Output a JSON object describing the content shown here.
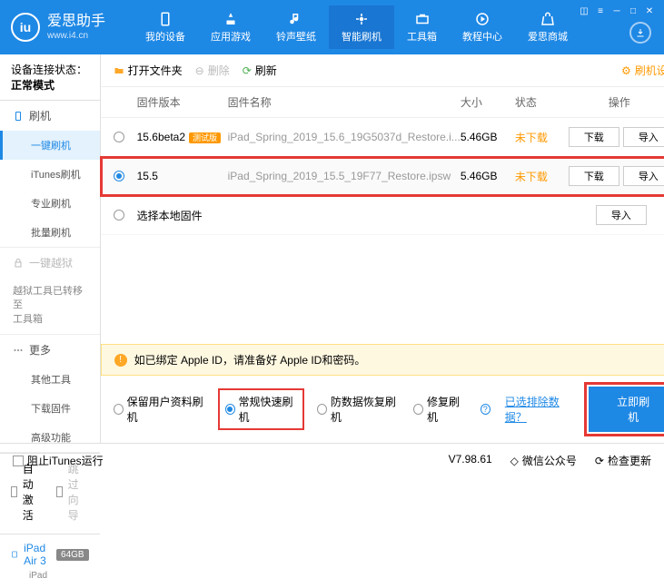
{
  "app": {
    "title": "爱思助手",
    "url": "www.i4.cn"
  },
  "nav": [
    {
      "label": "我的设备"
    },
    {
      "label": "应用游戏"
    },
    {
      "label": "铃声壁纸"
    },
    {
      "label": "智能刷机"
    },
    {
      "label": "工具箱"
    },
    {
      "label": "教程中心"
    },
    {
      "label": "爱思商城"
    }
  ],
  "sidebar": {
    "status_label": "设备连接状态：",
    "status_value": "正常模式",
    "s1": {
      "title": "刷机",
      "items": [
        "一键刷机",
        "iTunes刷机",
        "专业刷机",
        "批量刷机"
      ]
    },
    "s2": {
      "title": "一键越狱",
      "note": "越狱工具已转移至\n工具箱"
    },
    "s3": {
      "title": "更多",
      "items": [
        "其他工具",
        "下载固件",
        "高级功能"
      ]
    },
    "auto_activate": "自动激活",
    "skip_guide": "跳过向导",
    "device": {
      "name": "iPad Air 3",
      "storage": "64GB",
      "type": "iPad"
    }
  },
  "toolbar": {
    "open": "打开文件夹",
    "delete": "删除",
    "refresh": "刷新",
    "settings": "刷机设置"
  },
  "table": {
    "h_version": "固件版本",
    "h_name": "固件名称",
    "h_size": "大小",
    "h_status": "状态",
    "h_actions": "操作",
    "rows": [
      {
        "version": "15.6beta2",
        "beta": "测试版",
        "name": "iPad_Spring_2019_15.6_19G5037d_Restore.i...",
        "size": "5.46GB",
        "status": "未下载",
        "selected": false,
        "highlighted": false
      },
      {
        "version": "15.5",
        "beta": "",
        "name": "iPad_Spring_2019_15.5_19F77_Restore.ipsw",
        "size": "5.46GB",
        "status": "未下载",
        "selected": true,
        "highlighted": true
      }
    ],
    "local_option": "选择本地固件",
    "btn_download": "下载",
    "btn_import": "导入"
  },
  "warning": "如已绑定 Apple ID，请准备好 Apple ID和密码。",
  "options": {
    "keep": "保留用户资料刷机",
    "normal": "常规快速刷机",
    "anti": "防数据恢复刷机",
    "repair": "修复刷机",
    "exclude_link": "已选排除数据？",
    "flash_btn": "立即刷机"
  },
  "footer": {
    "block": "阻止iTunes运行",
    "version": "V7.98.61",
    "wechat": "微信公众号",
    "update": "检查更新"
  }
}
